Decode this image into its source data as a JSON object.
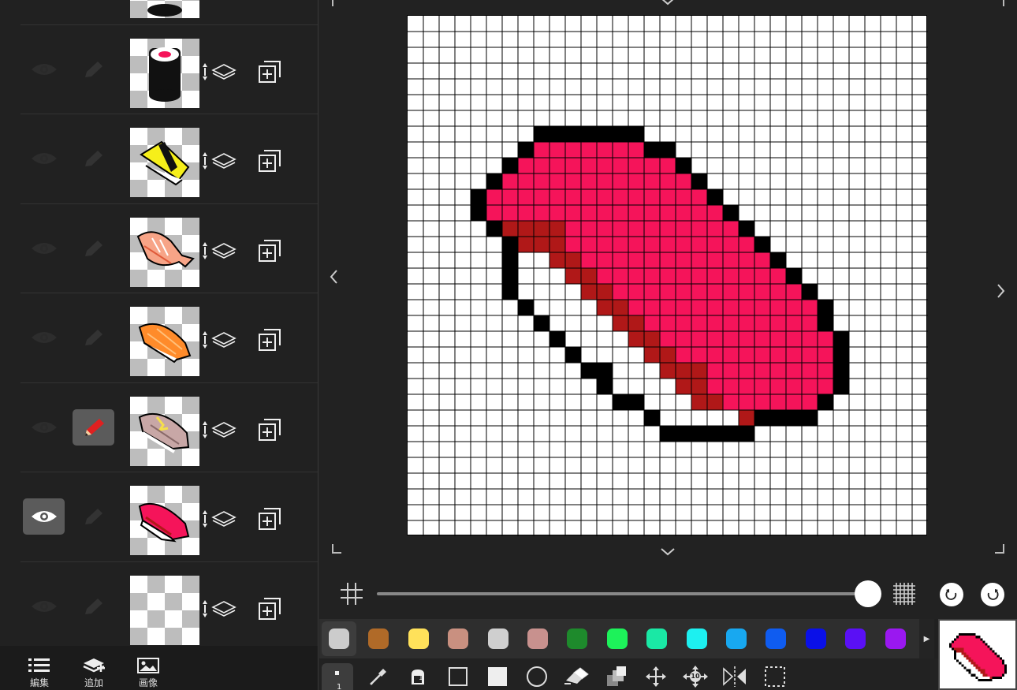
{
  "sidebar": {
    "layers": [
      {
        "id": "partial-top",
        "thumb": "sushi-partial",
        "visible": false,
        "editing": false
      },
      {
        "id": "maki",
        "thumb": "maki",
        "visible": false,
        "editing": false
      },
      {
        "id": "tamago",
        "thumb": "tamago",
        "visible": false,
        "editing": false
      },
      {
        "id": "ebi",
        "thumb": "ebi",
        "visible": false,
        "editing": false
      },
      {
        "id": "salmon",
        "thumb": "salmon",
        "visible": false,
        "editing": false
      },
      {
        "id": "aji",
        "thumb": "aji",
        "visible": false,
        "editing": true
      },
      {
        "id": "maguro",
        "thumb": "maguro",
        "visible": true,
        "editing": false
      },
      {
        "id": "empty",
        "thumb": "empty",
        "visible": false,
        "editing": false
      }
    ],
    "bottom": {
      "edit_label": "編集",
      "add_label": "追加",
      "image_label": "画像"
    }
  },
  "canvas": {
    "grid_cells": 33,
    "background": "#ffffff",
    "slider_value": 1.0
  },
  "palette": {
    "selected_index": 0,
    "colors": [
      "#cccccc",
      "#b06a28",
      "#ffe15a",
      "#c99080",
      "#cfcfcf",
      "#c8918e",
      "#1e8a2c",
      "#1df25a",
      "#1ae8a5",
      "#1df0f0",
      "#18a8f0",
      "#0f5cf0",
      "#0a10e8",
      "#5a10f5",
      "#9a18f0"
    ]
  },
  "tools": {
    "brush_size": "1",
    "layer_badge": "1",
    "move_step": "10"
  }
}
